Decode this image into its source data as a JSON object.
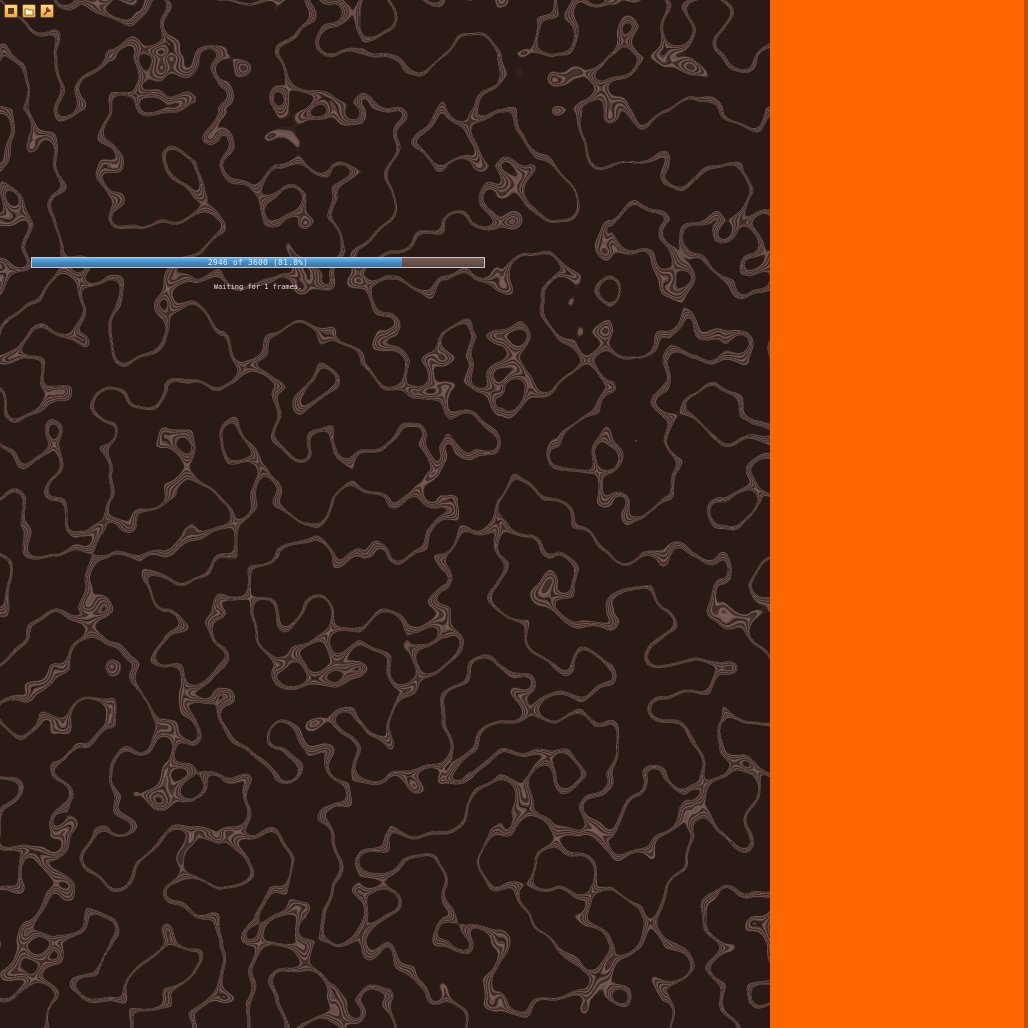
{
  "toolbar": {
    "buttons": [
      {
        "name": "stop",
        "icon": "stop-icon"
      },
      {
        "name": "open",
        "icon": "folder-icon"
      },
      {
        "name": "tools",
        "icon": "wrench-icon"
      }
    ]
  },
  "progress": {
    "text": "2946 of 3600 (81.8%)",
    "fraction": 0.818
  },
  "status": {
    "text": "Waiting for 1 frames."
  },
  "colors": {
    "background": "#2a1a15",
    "pattern": "#4a2c26",
    "sidebar": "#ff6600",
    "progress_fill": "#3d88c4"
  }
}
